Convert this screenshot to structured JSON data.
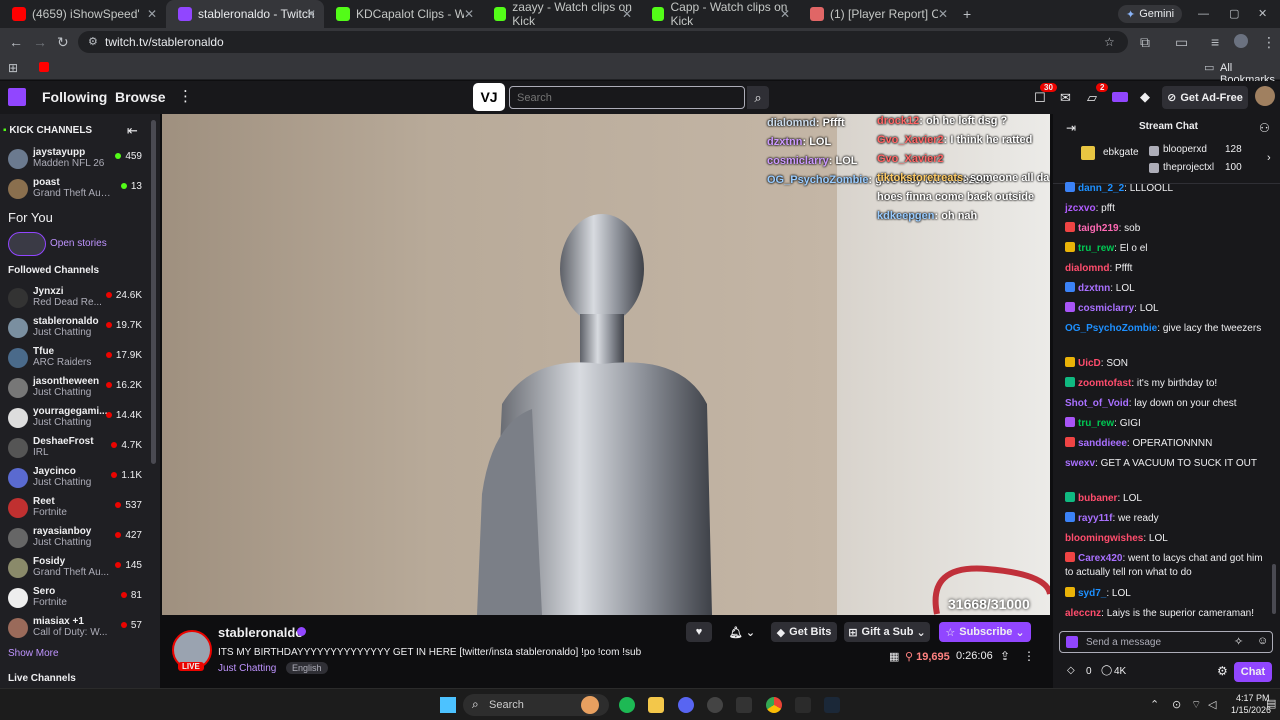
{
  "browser": {
    "tabs": [
      {
        "title": "(4659) iShowSpeed's First Time",
        "color": "#ff0000"
      },
      {
        "title": "stableronaldo - Twitch",
        "color": "#9146ff"
      },
      {
        "title": "KDCapalot Clips - Watch Live o",
        "color": "#53fc18"
      },
      {
        "title": "zaayy - Watch clips on Kick",
        "color": "#53fc18"
      },
      {
        "title": "Capp - Watch clips on Kick",
        "color": "#53fc18"
      },
      {
        "title": "(1) [Player Report] CallUpJefe |",
        "color": "#e06666"
      }
    ],
    "gemini_label": "Gemini",
    "url": "twitch.tv/stableronaldo",
    "all_bookmarks": "All Bookmarks"
  },
  "topnav": {
    "following": "Following",
    "browse": "Browse",
    "search_placeholder": "Search",
    "notif_count": "30",
    "whisper_count": "2",
    "ad_free": "Get Ad-Free"
  },
  "sidebar": {
    "kick_header": "KICK CHANNELS",
    "kick": [
      {
        "name": "jaystayupp",
        "game": "Madden NFL 26",
        "viewers": "459",
        "color": "#6b7a8f"
      },
      {
        "name": "poast",
        "game": "Grand Theft Aut...",
        "viewers": "13",
        "color": "#8a6f4e"
      }
    ],
    "for_you": "For You",
    "open_stories": "Open stories",
    "followed_header": "Followed Channels",
    "followed": [
      {
        "name": "Jynxzi",
        "game": "Red Dead Re...",
        "viewers": "24.6K",
        "color": "#333"
      },
      {
        "name": "stableronaldo",
        "game": "Just Chatting",
        "viewers": "19.7K",
        "color": "#7a8fa0"
      },
      {
        "name": "Tfue",
        "game": "ARC Raiders",
        "viewers": "17.9K",
        "color": "#4a6a8a"
      },
      {
        "name": "jasontheween",
        "game": "Just Chatting",
        "viewers": "16.2K",
        "color": "#777"
      },
      {
        "name": "yourragegami...",
        "game": "Just Chatting",
        "viewers": "14.4K",
        "color": "#ddd"
      },
      {
        "name": "DeshaeFrost",
        "game": "IRL",
        "viewers": "4.7K",
        "color": "#555"
      },
      {
        "name": "Jaycinco",
        "game": "Just Chatting",
        "viewers": "1.1K",
        "color": "#5a6ad0"
      },
      {
        "name": "Reet",
        "game": "Fortnite",
        "viewers": "537",
        "color": "#c03030"
      },
      {
        "name": "rayasianboy",
        "game": "Just Chatting",
        "viewers": "427",
        "color": "#666"
      },
      {
        "name": "Fosidy",
        "game": "Grand Theft Au...",
        "viewers": "145",
        "color": "#8a8a6a"
      },
      {
        "name": "Sero",
        "game": "Fortnite",
        "viewers": "81",
        "color": "#eee"
      },
      {
        "name": "miasiax +1",
        "game": "Call of Duty: W...",
        "viewers": "57",
        "color": "#9a6a5a"
      }
    ],
    "show_more": "Show More",
    "live_channels": "Live Channels"
  },
  "video": {
    "goal_counter": "31668/31000",
    "overlay_msgs": [
      {
        "user": "dialomnd",
        "text": "Pffft"
      },
      {
        "user": "dzxtnn",
        "text": "LOL"
      },
      {
        "user": "cosmiclarry",
        "text": "LOL"
      },
      {
        "user": "OG_PsychoZombie",
        "text": "give lacy the tweezers"
      },
      {
        "user": "Gvo_Xavier2",
        "text": "I think he ratted"
      },
      {
        "user": "Gvo_Xavier2",
        "text": ""
      },
      {
        "user": "tiktokstoretreats",
        "text": "someone all da hoes finna come back outside"
      },
      {
        "user": "kdkeepgen",
        "text": "oh nah"
      },
      {
        "user": "drock12",
        "text": "oh he left dsg ?"
      }
    ]
  },
  "stream": {
    "channel": "stableronaldo",
    "title": "ITS MY BIRTHDAYYYYYYYYYYYYYY GET IN HERE [twitter/insta stableronaldo] !po !com !sub",
    "category": "Just Chatting",
    "tag": "English",
    "live": "LIVE",
    "viewers": "19,695",
    "uptime": "0:26:06",
    "get_bits": "Get Bits",
    "gift_sub": "Gift a Sub",
    "subscribe": "Subscribe"
  },
  "chat": {
    "header": "Stream Chat",
    "gifters": [
      {
        "name": "ebkgate",
        "count": ""
      },
      {
        "name": "blooperxd",
        "count": "128"
      },
      {
        "name": "theprojectxl",
        "count": "100"
      }
    ],
    "messages": [
      {
        "user": "dann_2_2",
        "text": "LLLOOLL",
        "color": "#1e90ff"
      },
      {
        "user": "jzcxvo",
        "text": "pfft",
        "color": "#b05cff"
      },
      {
        "user": "taigh219",
        "text": "sob",
        "color": "#ff69b4"
      },
      {
        "user": "tru_rew",
        "text": "El o el",
        "color": "#00c853"
      },
      {
        "user": "dialomnd",
        "text": "Pffft",
        "color": "#ff4d6d"
      },
      {
        "user": "dzxtnn",
        "text": "LOL",
        "color": "#a970ff"
      },
      {
        "user": "cosmiclarry",
        "text": "LOL",
        "color": "#a970ff"
      },
      {
        "user": "OG_PsychoZombie",
        "text": "give lacy the tweezers",
        "color": "#1e90ff"
      },
      {
        "user": "UicD",
        "text": "SON",
        "color": "#ff4d6d"
      },
      {
        "user": "zoomtofast",
        "text": "it's my birthday to!",
        "color": "#ff4d6d"
      },
      {
        "user": "Shot_of_Void",
        "text": "lay down on your chest",
        "color": "#a970ff"
      },
      {
        "user": "tru_rew",
        "text": "GIGI",
        "color": "#00c853"
      },
      {
        "user": "sanddieee",
        "text": "OPERATIONNNN",
        "color": "#a970ff"
      },
      {
        "user": "swexv",
        "text": "GET A VACUUM TO SUCK IT OUT",
        "color": "#a970ff"
      },
      {
        "user": "bubaner",
        "text": "LOL",
        "color": "#ff4d6d"
      },
      {
        "user": "rayy11f",
        "text": "we ready",
        "color": "#a970ff"
      },
      {
        "user": "bloomingwishes",
        "text": "LOL",
        "color": "#ff4d6d"
      },
      {
        "user": "Carex420",
        "text": "went to lacys chat and got him to actually tell ron what to do",
        "color": "#a970ff"
      },
      {
        "user": "syd7_",
        "text": "LOL",
        "color": "#1e90ff"
      },
      {
        "user": "aleccnz",
        "text": "Laiys is the superior cameraman!",
        "color": "#ff4d6d"
      }
    ],
    "input_placeholder": "Send a message",
    "points": "0",
    "points2": "4K",
    "chat_button": "Chat"
  },
  "taskbar": {
    "search": "Search",
    "time": "4:17 PM",
    "date": "1/15/2026"
  }
}
